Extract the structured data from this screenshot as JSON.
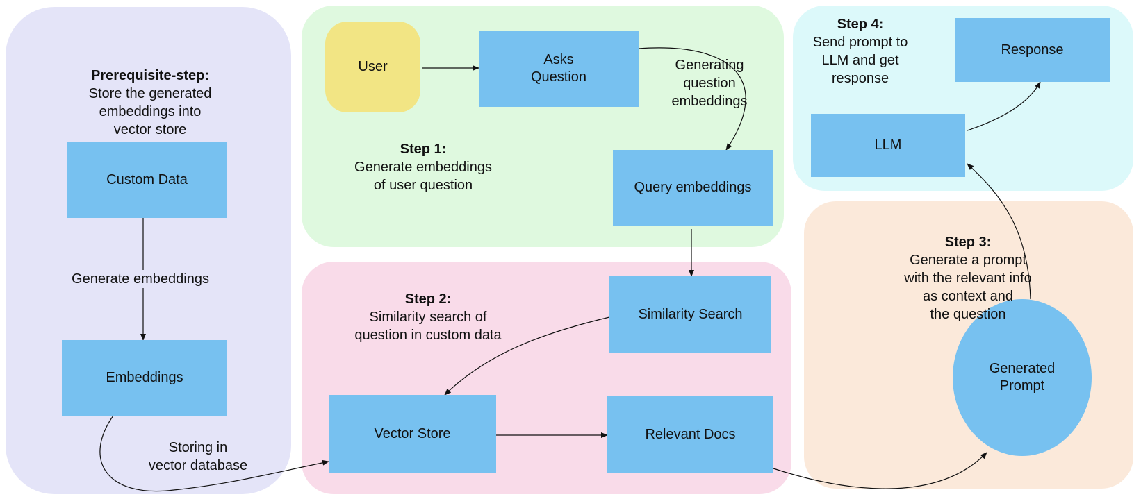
{
  "colors": {
    "prerequisite_panel": "#e4e4f8",
    "step1_panel": "#dff9df",
    "step2_panel": "#f9dbe9",
    "step3_panel": "#fbe9da",
    "step4_panel": "#dcf9fa",
    "node": "#77c1f0",
    "user_node": "#f2e584"
  },
  "prerequisite": {
    "title": "Prerequisite-step:",
    "lines": [
      "Store the generated",
      "embeddings into",
      "vector store"
    ],
    "nodes": {
      "custom_data": "Custom Data",
      "embeddings": "Embeddings"
    },
    "edge_generate": "Generate embeddings",
    "edge_storing": [
      "Storing in",
      "vector database"
    ]
  },
  "step1": {
    "title": "Step 1:",
    "lines": [
      "Generate embeddings",
      "of user question"
    ],
    "nodes": {
      "user": "User",
      "asks_question": "Asks\nQuestion",
      "query_embeddings": "Query embeddings"
    },
    "edge_generating": [
      "Generating",
      "question",
      "embeddings"
    ]
  },
  "step2": {
    "title": "Step 2:",
    "lines": [
      "Similarity search of",
      "question in custom data"
    ],
    "nodes": {
      "similarity_search": "Similarity Search",
      "vector_store": "Vector Store",
      "relevant_docs": "Relevant Docs"
    }
  },
  "step3": {
    "title": "Step 3:",
    "lines": [
      "Generate a prompt",
      "with the relevant info",
      "as context and",
      "the question"
    ],
    "nodes": {
      "generated_prompt": "Generated\nPrompt"
    }
  },
  "step4": {
    "title": "Step 4:",
    "lines": [
      "Send prompt to",
      "LLM and get",
      "response"
    ],
    "nodes": {
      "llm": "LLM",
      "response": "Response"
    }
  }
}
